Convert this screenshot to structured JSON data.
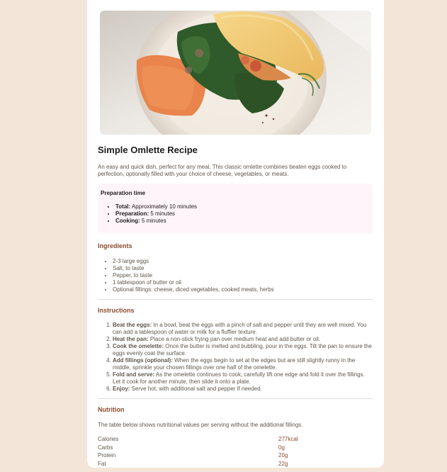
{
  "recipe": {
    "title": "Simple Omlette Recipe",
    "intro": "An easy and quick dish, perfect for any meal. This classic omlette combines beaten eggs cooked to perfection, optionally filled with your choice of cheese, vegetables, or meats."
  },
  "prep": {
    "heading": "Preparation time",
    "items": [
      {
        "label": "Total:",
        "text": " Approximately 10 minutes"
      },
      {
        "label": "Preparation:",
        "text": " 5 minutes"
      },
      {
        "label": "Cooking:",
        "text": " 5 minutes"
      }
    ]
  },
  "ingredients": {
    "heading": "Ingredients",
    "items": [
      "2-3 large eggs",
      "Salt, to taste",
      "Pepper, to taste",
      "1 tablespoon of butter or oil",
      "Optional fillings: cheese, diced vegetables, cooked meats, herbs"
    ]
  },
  "instructions": {
    "heading": "Instructions",
    "steps": [
      {
        "label": "Beat the eggs:",
        "text": " In a bowl, beat the eggs with a pinch of salt and pepper until they are well mixed. You can add a tablespoon of water or milk for a fluffier texture."
      },
      {
        "label": "Heat the pan:",
        "text": " Place a non-stick frying pan over medium heat and add butter or oil."
      },
      {
        "label": "Cook the omelette:",
        "text": " Once the butter is melted and bubbling, pour in the eggs. Tilt the pan to ensure the eggs evenly coat the surface."
      },
      {
        "label": "Add fillings (optional):",
        "text": " When the eggs begin to set at the edges but are still slightly runny in the middle, sprinkle your chosen fillings over one half of the omelette."
      },
      {
        "label": "Fold and serve:",
        "text": " As the omelette continues to cook, carefully lift one edge and fold it over the fillings. Let it cook for another minute, then slide it onto a plate."
      },
      {
        "label": "Enjoy:",
        "text": " Serve hot, with additional salt and pepper if needed."
      }
    ]
  },
  "nutrition": {
    "heading": "Nutrition",
    "description": "The table below shows nutritional values per serving without the additional fillings.",
    "rows": [
      {
        "label": "Calories",
        "value": "277kcal"
      },
      {
        "label": "Carbs",
        "value": "0g"
      },
      {
        "label": "Protein",
        "value": "20g"
      },
      {
        "label": "Fat",
        "value": "22g"
      }
    ]
  },
  "colors": {
    "page_background": "#f3e5d8",
    "card_background": "#ffffff",
    "accent_brown": "#8c4a2f",
    "prep_background": "#fff4fa",
    "body_text": "#5f564d"
  }
}
